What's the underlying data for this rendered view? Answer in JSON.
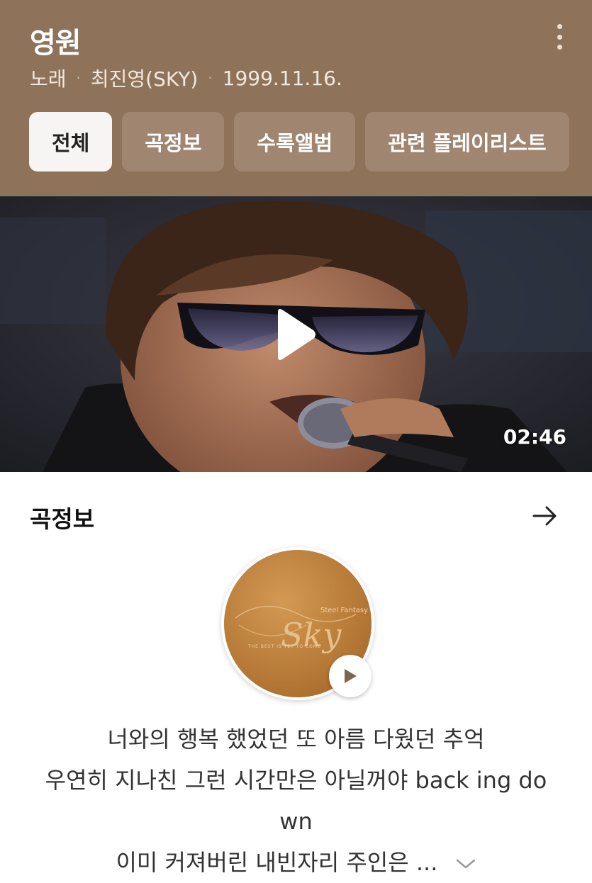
{
  "song": {
    "title": "영원",
    "type": "노래",
    "artist": "최진영(SKY)",
    "date": "1999.11.16."
  },
  "tabs": [
    {
      "label": "전체",
      "active": true
    },
    {
      "label": "곡정보",
      "active": false
    },
    {
      "label": "수록앨범",
      "active": false
    },
    {
      "label": "관련 플레이리스트",
      "active": false
    }
  ],
  "video": {
    "duration": "02:46"
  },
  "info_section": {
    "title": "곡정보",
    "album_art_text": "Sky",
    "album_art_subtitle": "Steel Fantasy",
    "album_art_tagline": "THE BEST IS YET TO COME"
  },
  "lyrics": {
    "lines": [
      "너와의 행복 했었던 또 아름 다웠던 추억",
      "우연히 지나친 그런 시간만은 아닐꺼야 back ing do",
      "wn",
      "이미 커져버린 내빈자리 주인은 ..."
    ]
  },
  "colors": {
    "header_bg": "#8e735a",
    "accent": "#8e735a"
  }
}
